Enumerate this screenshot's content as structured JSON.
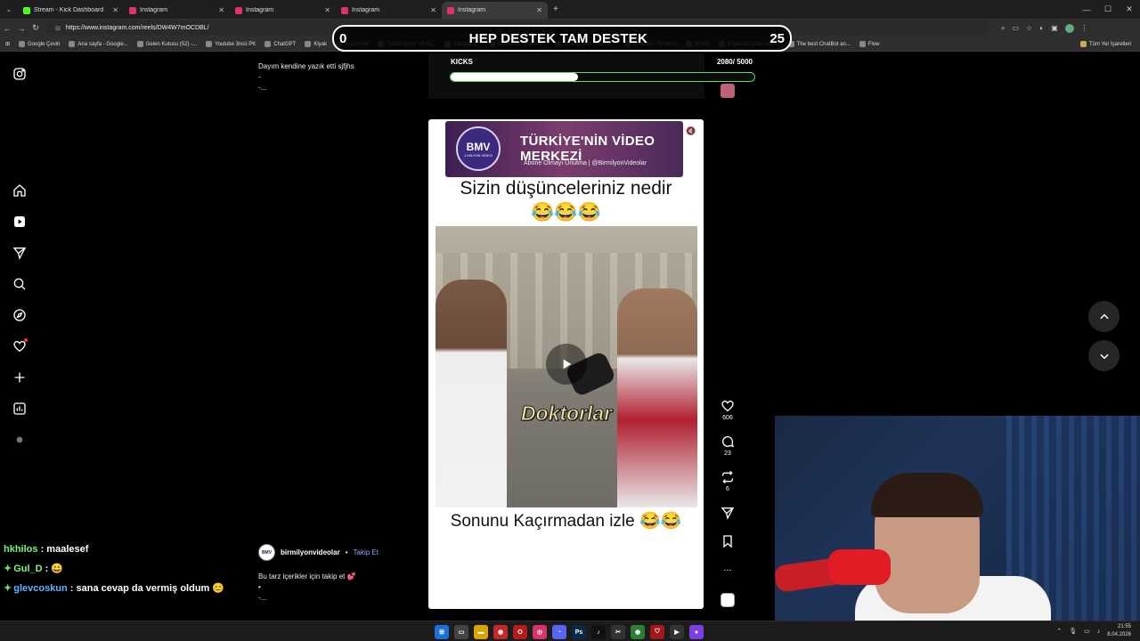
{
  "browser": {
    "tabs": [
      {
        "title": "Stream - Kick Dashboard",
        "color": "#53fc18",
        "active": false
      },
      {
        "title": "Instagram",
        "color": "#e1306c",
        "active": false
      },
      {
        "title": "Instagram",
        "color": "#e1306c",
        "active": false
      },
      {
        "title": "Instagram",
        "color": "#e1306c",
        "active": false
      },
      {
        "title": "Instagram",
        "color": "#e1306c",
        "active": true
      }
    ],
    "url": "https://www.instagram.com/reels/DW4W7mOCDBL/",
    "bookmarks": [
      "Google Çeviri",
      "Ana sayfa - Google...",
      "Gelen Kutusu (52) -...",
      "Youtube 3ncü PK",
      "ChatGPT",
      "Kiyak",
      "İlişi Örnek",
      "Transcript of \"Mi M...",
      "Sahaga 3...",
      "Estimator Uniwers...",
      "Quotes and Mood E...",
      "HeyGen - Projects",
      "BURÇ",
      "Esperanza/site web...",
      "The best ChatBot an...",
      "Flow"
    ],
    "bookmarks_right": "Tüm Yer İşaretleri"
  },
  "overlay": {
    "left_num": "0",
    "title": "HEP DESTEK TAM DESTEK",
    "right_num": "25"
  },
  "kicks": {
    "label": "KICKS",
    "count": "2080/ 5000",
    "progress": 0.42
  },
  "post": {
    "caption_top": [
      "Dayım kendine yazık etti sjfjhs",
      "-",
      "-..."
    ],
    "author": "birmilyonvideolar",
    "author_badge": "BMV",
    "separator": "•",
    "follow": "Takip Et",
    "caption_bottom": [
      "Bu tarz içerikler için takip et 💕",
      "•",
      "-..."
    ]
  },
  "reel": {
    "banner_logo": "BMV",
    "banner_logo_sub": "1 MİLYON VİDEO",
    "banner_title": "TÜRKİYE'NİN VİDEO MERKEZİ",
    "banner_sub": "Abone Olmayı Unutma | @BirmilyonVideolar",
    "question": "Sizin düşünceleriniz nedir",
    "emoji": "😂😂😂",
    "subtitle": "Doktorlar",
    "bottom_text": "Sonunu Kaçırmadan izle 😂😂"
  },
  "actions": {
    "likes": "606",
    "comments": "23",
    "reposts": "6",
    "more": "..."
  },
  "chat": [
    {
      "user": "hkhilos",
      "msg": "maalesef",
      "badge": ""
    },
    {
      "user": "Gul_D",
      "msg": "😀",
      "badge": "✦"
    },
    {
      "user": "glevcoskun",
      "msg": "sana cevap da vermiş oldum 😊",
      "badge": "✦"
    }
  ],
  "taskbar": {
    "time": "21:55",
    "date": "8.04.2026"
  }
}
